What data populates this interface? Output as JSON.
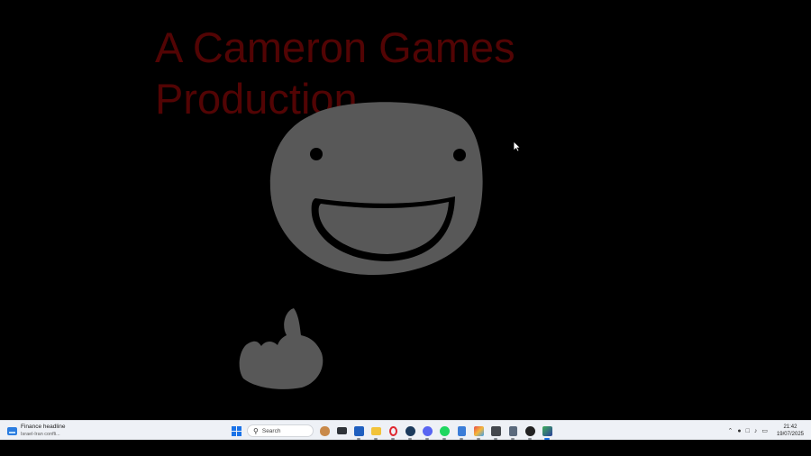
{
  "game": {
    "title": "A Cameron Games\nProduction.",
    "title_color": "#520404",
    "drawing_color": "#585858"
  },
  "taskbar": {
    "widget": {
      "headline": "Finance headline",
      "subtext": "Israel-Iran confli..."
    },
    "search": {
      "placeholder": "Search"
    },
    "apps": [
      {
        "name": "start",
        "icon": "windows-start-icon"
      },
      {
        "name": "task-view",
        "icon": "task-view-icon"
      },
      {
        "name": "store",
        "icon": "store-icon"
      },
      {
        "name": "file-explorer",
        "icon": "folder-icon"
      },
      {
        "name": "opera",
        "icon": "opera-icon"
      },
      {
        "name": "steam",
        "icon": "steam-icon"
      },
      {
        "name": "discord",
        "icon": "discord-icon"
      },
      {
        "name": "spotify",
        "icon": "spotify-icon"
      },
      {
        "name": "notepad",
        "icon": "notepad-icon"
      },
      {
        "name": "paint",
        "icon": "paint-icon"
      },
      {
        "name": "media",
        "icon": "media-icon"
      },
      {
        "name": "calculator",
        "icon": "calculator-icon"
      },
      {
        "name": "obs",
        "icon": "obs-icon"
      },
      {
        "name": "game",
        "icon": "game-icon"
      }
    ],
    "clock": {
      "time": "21:42",
      "date": "19/07/2025"
    }
  }
}
